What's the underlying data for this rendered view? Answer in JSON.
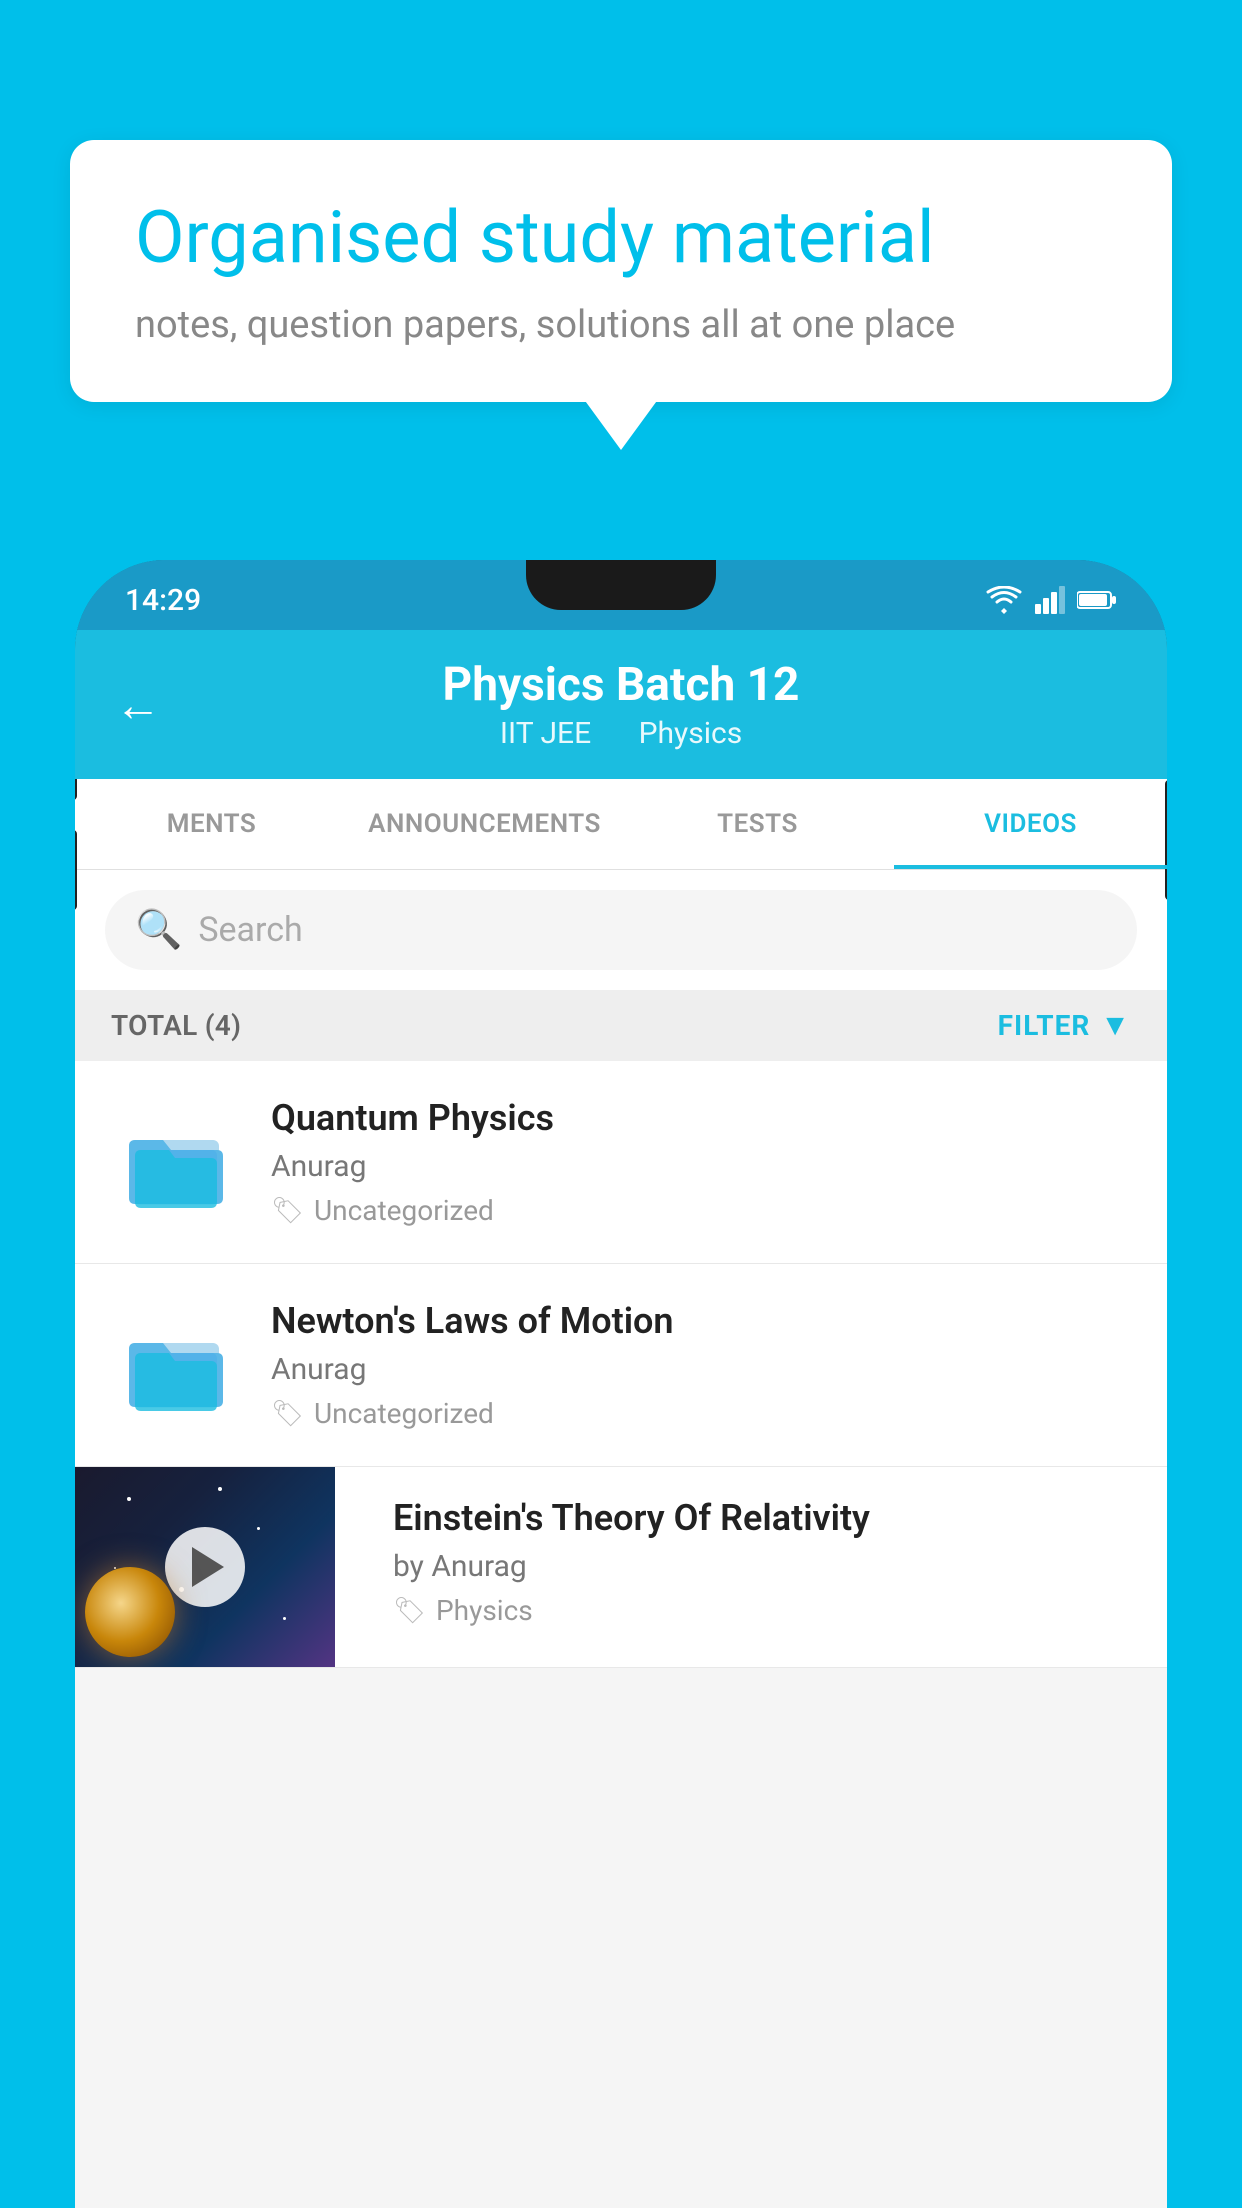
{
  "background_color": "#00BFEA",
  "bubble": {
    "title": "Organised study material",
    "subtitle": "notes, question papers, solutions all at one place"
  },
  "status_bar": {
    "time": "14:29"
  },
  "header": {
    "back_label": "←",
    "title": "Physics Batch 12",
    "subtitle_part1": "IIT JEE",
    "subtitle_part2": "Physics"
  },
  "tabs": [
    {
      "label": "MENTS",
      "active": false
    },
    {
      "label": "ANNOUNCEMENTS",
      "active": false
    },
    {
      "label": "TESTS",
      "active": false
    },
    {
      "label": "VIDEOS",
      "active": true
    }
  ],
  "search": {
    "placeholder": "Search"
  },
  "filter": {
    "total_label": "TOTAL (4)",
    "filter_label": "FILTER"
  },
  "videos": [
    {
      "id": "1",
      "title": "Quantum Physics",
      "author": "Anurag",
      "tag": "Uncategorized",
      "has_thumb": false
    },
    {
      "id": "2",
      "title": "Newton's Laws of Motion",
      "author": "Anurag",
      "tag": "Uncategorized",
      "has_thumb": false
    },
    {
      "id": "3",
      "title": "Einstein's Theory Of Relativity",
      "author": "by Anurag",
      "tag": "Physics",
      "has_thumb": true
    }
  ]
}
